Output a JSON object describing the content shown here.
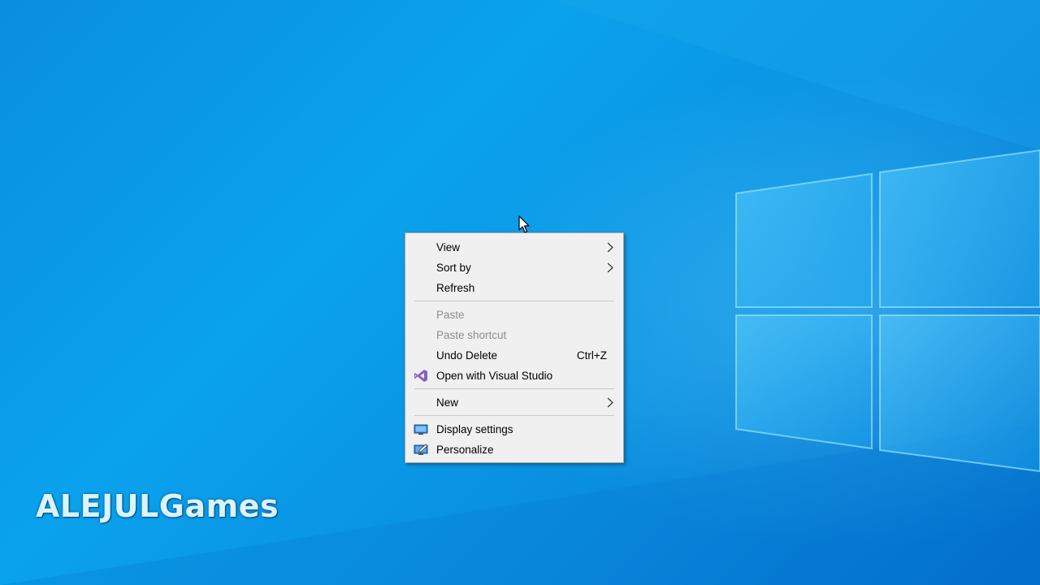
{
  "context_menu": {
    "items": [
      {
        "label": "View",
        "submenu": true
      },
      {
        "label": "Sort by",
        "submenu": true
      },
      {
        "label": "Refresh"
      },
      {
        "label": "Paste",
        "disabled": true
      },
      {
        "label": "Paste shortcut",
        "disabled": true
      },
      {
        "label": "Undo Delete",
        "shortcut": "Ctrl+Z"
      },
      {
        "label": "Open with Visual Studio",
        "icon": "visual-studio-icon"
      },
      {
        "label": "New",
        "submenu": true
      },
      {
        "label": "Display settings",
        "icon": "display-icon"
      },
      {
        "label": "Personalize",
        "icon": "personalize-icon"
      }
    ]
  },
  "watermark": {
    "text": "ALEJULGames"
  },
  "colors": {
    "desktop_blue": "#0a97e6",
    "menu_background": "#f0f0f0",
    "disabled_text": "#8d8d8d",
    "visual_studio_purple": "#865fc5"
  }
}
